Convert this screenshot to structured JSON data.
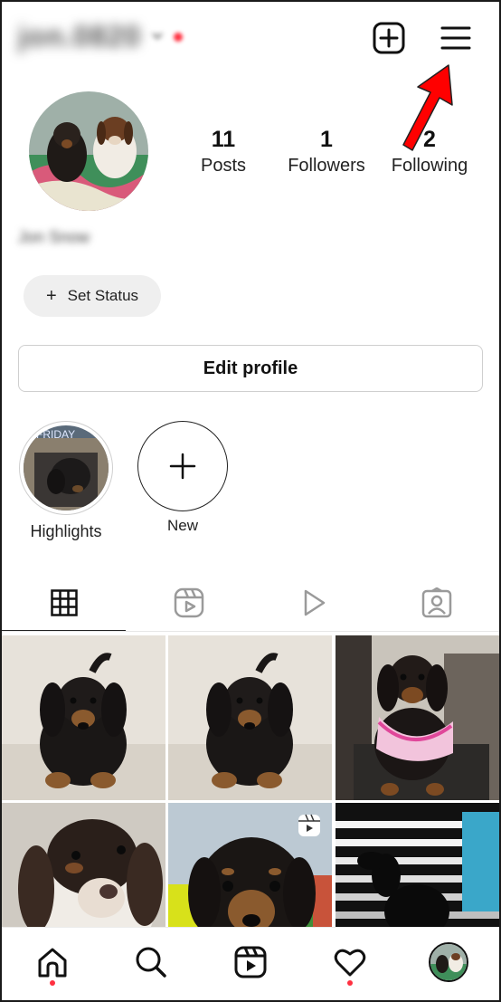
{
  "header": {
    "username": "jon.0820",
    "create_icon": "plus-square-icon",
    "menu_icon": "hamburger-menu-icon"
  },
  "profile": {
    "avatar_icon": "profile-photo-two-dachshunds",
    "stats": [
      {
        "value": "11",
        "label": "Posts"
      },
      {
        "value": "1",
        "label": "Followers"
      },
      {
        "value": "2",
        "label": "Following"
      }
    ],
    "full_name": "Jon Snow",
    "set_status_label": "Set Status",
    "edit_profile_label": "Edit profile"
  },
  "highlights": [
    {
      "label": "Highlights",
      "cover_text": "FRIDAY"
    },
    {
      "label": "New"
    }
  ],
  "tabs": [
    {
      "icon": "grid-icon",
      "active": true
    },
    {
      "icon": "reels-icon",
      "active": false
    },
    {
      "icon": "play-icon",
      "active": false
    },
    {
      "icon": "tagged-icon",
      "active": false
    }
  ],
  "grid_posts": [
    {
      "subject": "black-tan dachshund puppy lying on couch"
    },
    {
      "subject": "black-tan dachshund puppy lying on couch"
    },
    {
      "subject": "dachshund in pink harness on chair"
    },
    {
      "subject": "dapple dachshund face close-up"
    },
    {
      "subject": "dachshund close-up on colorful blanket",
      "badge": "reels-icon"
    },
    {
      "subject": "dachshund silhouette by window blinds"
    }
  ],
  "bottom_nav": [
    {
      "icon": "home-icon",
      "notification_dot": true
    },
    {
      "icon": "search-icon"
    },
    {
      "icon": "reels-icon"
    },
    {
      "icon": "heart-icon",
      "notification_dot": true
    },
    {
      "icon": "profile-avatar-icon"
    }
  ],
  "colors": {
    "notification": "#ff3040",
    "annotation_arrow": "#ff0000",
    "button_bg": "#efefef",
    "border": "#cfcfcf"
  }
}
